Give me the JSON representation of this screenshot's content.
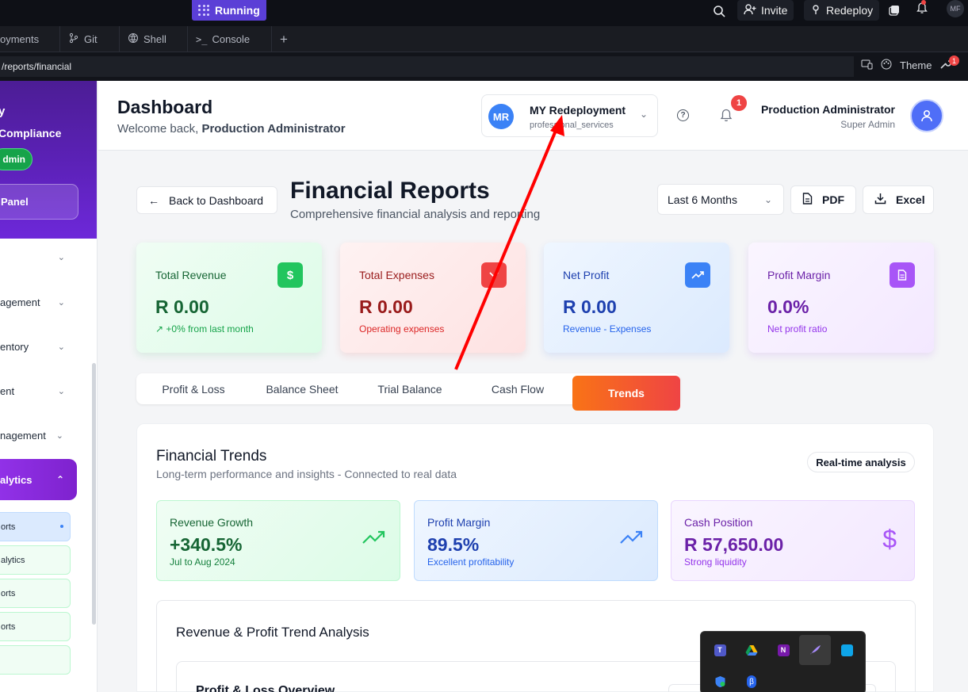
{
  "replit_topbar": {
    "status_label": "Running",
    "invite_label": "Invite",
    "redeploy_label": "Redeploy",
    "avatar_initials": "MF"
  },
  "replit_tabs": [
    {
      "label": "oyments"
    },
    {
      "label": "Git"
    },
    {
      "label": "Shell"
    },
    {
      "label": "Console"
    }
  ],
  "replit_url": {
    "path": "/reports/financial",
    "theme_label": "Theme",
    "badge": "1"
  },
  "sidebar": {
    "header_line1": "y",
    "header_line2": "Compliance",
    "admin_badge": "dmin",
    "panel_label": "Panel",
    "items": [
      {
        "label": ""
      },
      {
        "label": "agement"
      },
      {
        "label": "entory"
      },
      {
        "label": "ent"
      },
      {
        "label": "nagement"
      }
    ],
    "active_group": "alytics",
    "sub_items": [
      {
        "label": "orts"
      },
      {
        "label": "alytics"
      },
      {
        "label": "orts"
      },
      {
        "label": "orts"
      },
      {
        "label": ""
      }
    ]
  },
  "header": {
    "title": "Dashboard",
    "welcome_prefix": "Welcome back, ",
    "welcome_name": "Production Administrator",
    "org_initials": "MR",
    "org_name": "MY Redeployment",
    "org_type": "professional_services",
    "notification_count": "1",
    "user_name": "Production Administrator",
    "user_role": "Super Admin"
  },
  "page": {
    "back_label": "Back to Dashboard",
    "title": "Financial Reports",
    "subtitle": "Comprehensive financial analysis and reporting",
    "period": "Last 6 Months",
    "pdf_label": "PDF",
    "excel_label": "Excel"
  },
  "kpis": [
    {
      "label": "Total Revenue",
      "value": "R 0.00",
      "note": "+0% from last month",
      "color": "#16a34a"
    },
    {
      "label": "Total Expenses",
      "value": "R 0.00",
      "note": "Operating expenses",
      "color": "#dc2626"
    },
    {
      "label": "Net Profit",
      "value": "R 0.00",
      "note": "Revenue - Expenses",
      "color": "#1e40af"
    },
    {
      "label": "Profit Margin",
      "value": "0.0%",
      "note": "Net profit ratio",
      "color": "#7e22ce"
    }
  ],
  "report_tabs": [
    {
      "label": "Profit & Loss"
    },
    {
      "label": "Balance Sheet"
    },
    {
      "label": "Trial Balance"
    },
    {
      "label": "Cash Flow"
    },
    {
      "label": "Trends",
      "active": true
    }
  ],
  "trends": {
    "title": "Financial Trends",
    "subtitle": "Long-term performance and insights - Connected to real data",
    "badge": "Real-time analysis",
    "cards": [
      {
        "label": "Revenue Growth",
        "value": "+340.5%",
        "note": "Jul to Aug 2024",
        "icon": "trending-up-icon"
      },
      {
        "label": "Profit Margin",
        "value": "89.5%",
        "note": "Excellent profitability",
        "icon": "trending-up-icon"
      },
      {
        "label": "Cash Position",
        "value": "R 57,650.00",
        "note": "Strong liquidity",
        "icon": "dollar-icon"
      }
    ],
    "section_title": "Revenue & Profit Trend Analysis",
    "subsection_title": "Profit & Loss Overview"
  },
  "annotation": {
    "color": "#ff0000"
  }
}
